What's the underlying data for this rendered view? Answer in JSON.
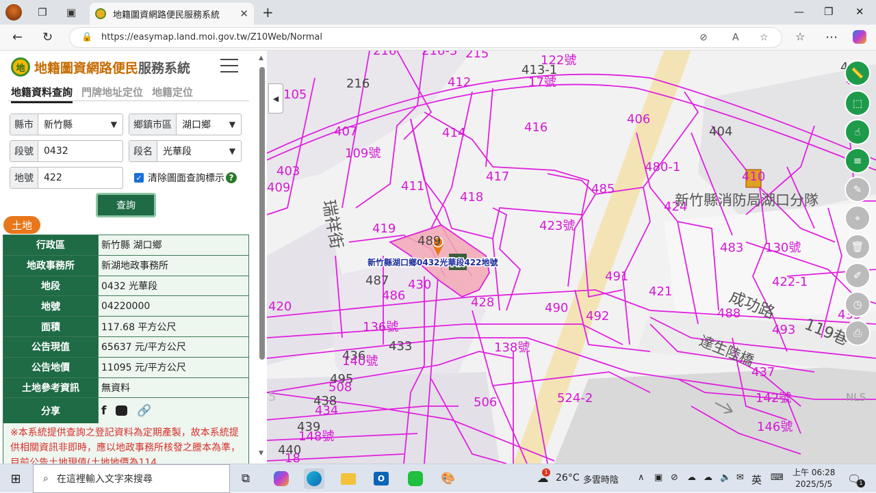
{
  "browser": {
    "tab_title": "地籍圖資網路便民服務系統",
    "url": "https://easymap.land.moi.gov.tw/Z10Web/Normal",
    "new_tab": "+"
  },
  "app": {
    "name_part1": "地籍圖資網路便民",
    "name_part2": "服務系統",
    "logo_text": "地",
    "tabs": [
      "地籍資料查詢",
      "門牌地址定位",
      "地籍定位"
    ],
    "fields": {
      "county_label": "縣市",
      "county_value": "新竹縣",
      "town_label": "鄉鎮市區",
      "town_value": "湖口鄉",
      "section_no_label": "段號",
      "section_no_value": "0432",
      "section_name_label": "段名",
      "section_name_value": "光華段",
      "lot_label": "地號",
      "lot_value": "422"
    },
    "clear_marker_label": "清除圖面查詢標示",
    "query_button": "查詢",
    "land_badge": "土地",
    "info_rows": [
      {
        "k": "行政區",
        "v": "新竹縣 湖口鄉"
      },
      {
        "k": "地政事務所",
        "v": "新湖地政事務所"
      },
      {
        "k": "地段",
        "v": "0432 光華段"
      },
      {
        "k": "地號",
        "v": "04220000"
      },
      {
        "k": "面積",
        "v": "117.68 平方公尺"
      },
      {
        "k": "公告現值",
        "v": "65637 元/平方公尺"
      },
      {
        "k": "公告地價",
        "v": "11095 元/平方公尺"
      },
      {
        "k": "土地參考資訊",
        "v": "無資料"
      }
    ],
    "share_label": "分享",
    "notice": "※本系統提供查詢之登記資料為定期產製，故本系統提供相關資訊非即時，應以地政事務所核發之謄本為準，目前公告土地現值(土地地價為114"
  },
  "map": {
    "marker_label": "新竹縣湖口鄉0432光華段422地號",
    "fire_station": "新竹縣消防局湖口分隊",
    "road_chenggong": "成功路",
    "road_ruixiang": "瑞祥街",
    "road_dasheng": "達生陸橋",
    "alley": "119巷",
    "nls": "NLS",
    "parcels": [
      "216",
      "216-3",
      "215",
      "122號",
      "413-1",
      "17號",
      "216",
      "412",
      "414",
      "416",
      "406",
      "407",
      "109號",
      "404",
      "403",
      "409",
      "411",
      "417",
      "480-1",
      "410",
      "418",
      "485",
      "424",
      "419",
      "423號",
      "489",
      "483",
      "130號",
      "487",
      "491",
      "422-1",
      "430",
      "486",
      "421",
      "428",
      "420",
      "490",
      "488",
      "492",
      "493",
      "435",
      "136號",
      "433",
      "138號",
      "436",
      "140號",
      "495",
      "437",
      "508",
      "524-2",
      "142號",
      "438",
      "434",
      "506",
      "146號",
      "439",
      "148號",
      "440",
      "18",
      "5",
      "105",
      "4",
      "新"
    ]
  },
  "taskbar": {
    "search_placeholder": "在這裡輸入文字來搜尋",
    "weather_temp": "26°C",
    "weather_desc": "多雲時陰",
    "ime": "英",
    "time": "上午 06:28",
    "date": "2025/5/5",
    "notif_count": "1",
    "weather_badge": "1"
  }
}
